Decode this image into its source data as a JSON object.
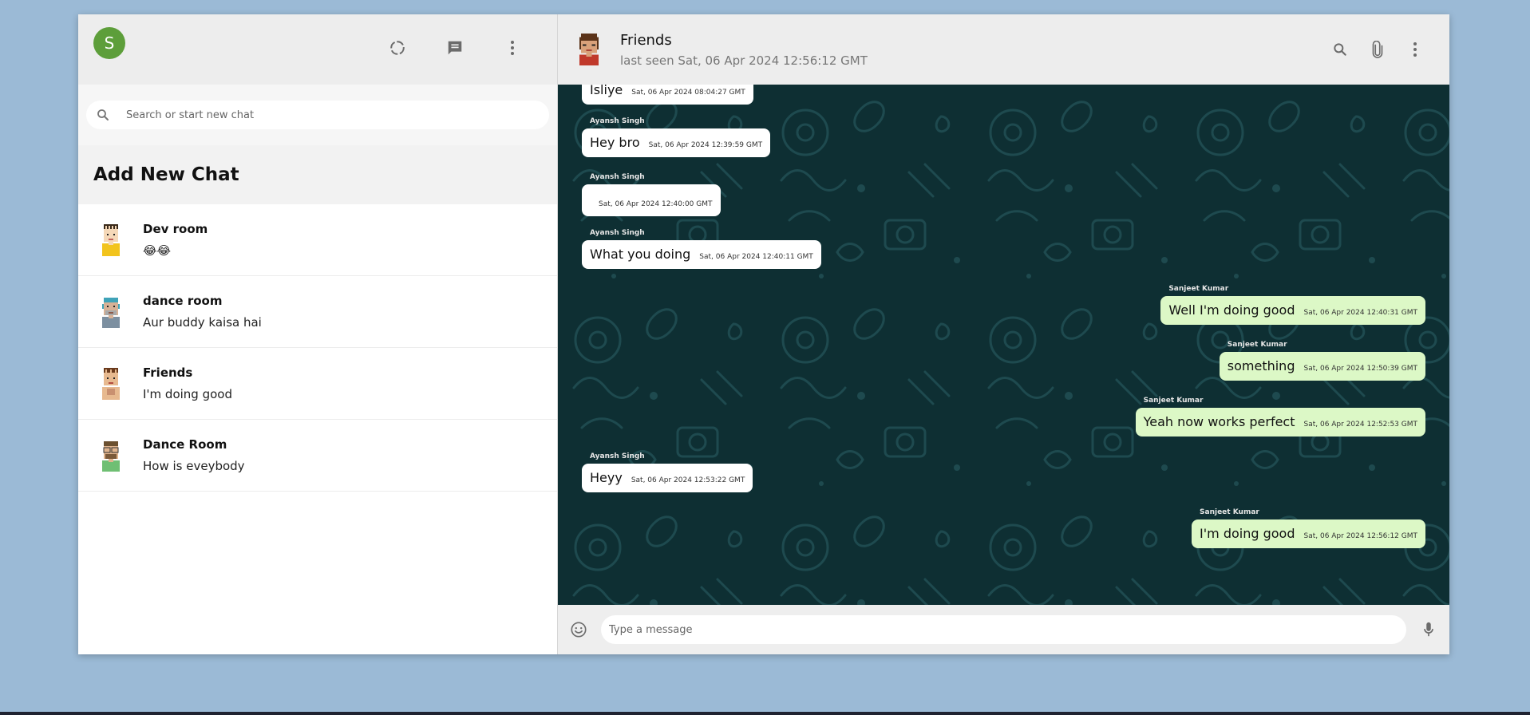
{
  "user": {
    "avatar_letter": "S",
    "avatar_color": "#5d9e3a"
  },
  "sidebar": {
    "icons": [
      "status-icon",
      "new-chat-icon",
      "menu-icon"
    ],
    "search_placeholder": "Search or start new chat",
    "add_new_chat": "Add New Chat",
    "chats": [
      {
        "name": "Dev room",
        "last": "😂😂"
      },
      {
        "name": "dance room",
        "last": "Aur buddy kaisa hai"
      },
      {
        "name": "Friends",
        "last": "I'm doing good"
      },
      {
        "name": "Dance Room",
        "last": "How is eveybody"
      }
    ]
  },
  "chat": {
    "title": "Friends",
    "status": "last seen Sat, 06 Apr 2024 12:56:12 GMT",
    "icons": [
      "search-icon",
      "attach-icon",
      "menu-icon"
    ],
    "messages": [
      {
        "sender": "",
        "text": "Isliye",
        "time": "Sat, 06 Apr 2024 08:04:27 GMT",
        "out": false
      },
      {
        "sender": "Ayansh Singh",
        "text": "Hey bro",
        "time": "Sat, 06 Apr 2024 12:39:59 GMT",
        "out": false
      },
      {
        "sender": "Ayansh Singh",
        "text": "",
        "time": "Sat, 06 Apr 2024 12:40:00 GMT",
        "out": false
      },
      {
        "sender": "Ayansh Singh",
        "text": "What you doing",
        "time": "Sat, 06 Apr 2024 12:40:11 GMT",
        "out": false
      },
      {
        "sender": "Sanjeet Kumar",
        "text": "Well I'm doing good",
        "time": "Sat, 06 Apr 2024 12:40:31 GMT",
        "out": true
      },
      {
        "sender": "Sanjeet Kumar",
        "text": "something",
        "time": "Sat, 06 Apr 2024 12:50:39 GMT",
        "out": true
      },
      {
        "sender": "Sanjeet Kumar",
        "text": "Yeah now works perfect",
        "time": "Sat, 06 Apr 2024 12:52:53 GMT",
        "out": true
      },
      {
        "sender": "Ayansh Singh",
        "text": "Heyy",
        "time": "Sat, 06 Apr 2024 12:53:22 GMT",
        "out": false
      },
      {
        "sender": "Sanjeet Kumar",
        "text": "I'm doing good",
        "time": "Sat, 06 Apr 2024 12:56:12 GMT",
        "out": true
      }
    ],
    "composer_placeholder": "Type a message"
  },
  "colors": {
    "chat_bg": "#0e2f33",
    "outgoing_bubble": "#dcf8c6",
    "incoming_bubble": "#ffffff",
    "header_bg": "#ededed",
    "page_bg": "#9bbad6"
  }
}
